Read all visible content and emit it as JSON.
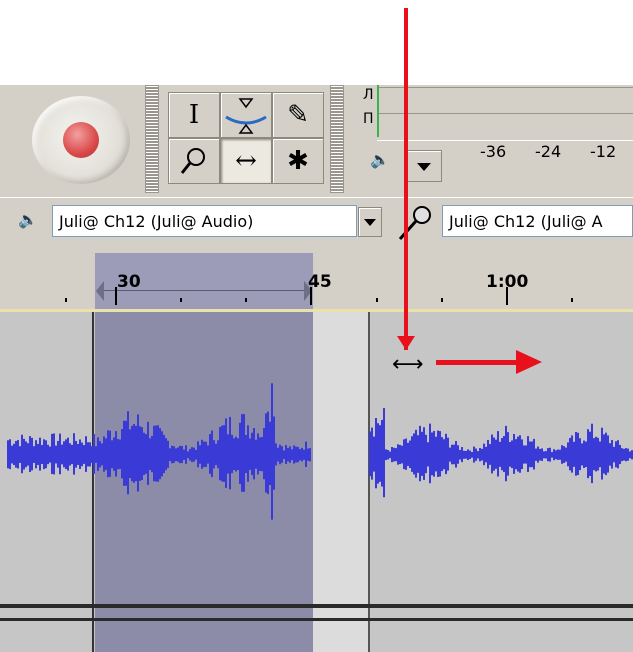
{
  "toolbar": {
    "record_icon": "record-icon",
    "tools": {
      "selection": "I",
      "envelope": "envelope-icon",
      "draw": "✎",
      "zoom": "⚲",
      "timeshift": "↔",
      "multi": "✱"
    }
  },
  "meter": {
    "left_channel": "Л",
    "right_channel": "П",
    "ticks": [
      "-36",
      "-24",
      "-12"
    ]
  },
  "device": {
    "playback_device": "Juli@ Ch12 (Juli@ Audio)",
    "recording_device": "Juli@ Ch12 (Juli@ A"
  },
  "ruler": {
    "labels": [
      "30",
      "45",
      "1:00"
    ]
  },
  "colors": {
    "waveform": "#3a3ad6",
    "selection": "#8c8ca8",
    "annotation": "#e8101a"
  }
}
